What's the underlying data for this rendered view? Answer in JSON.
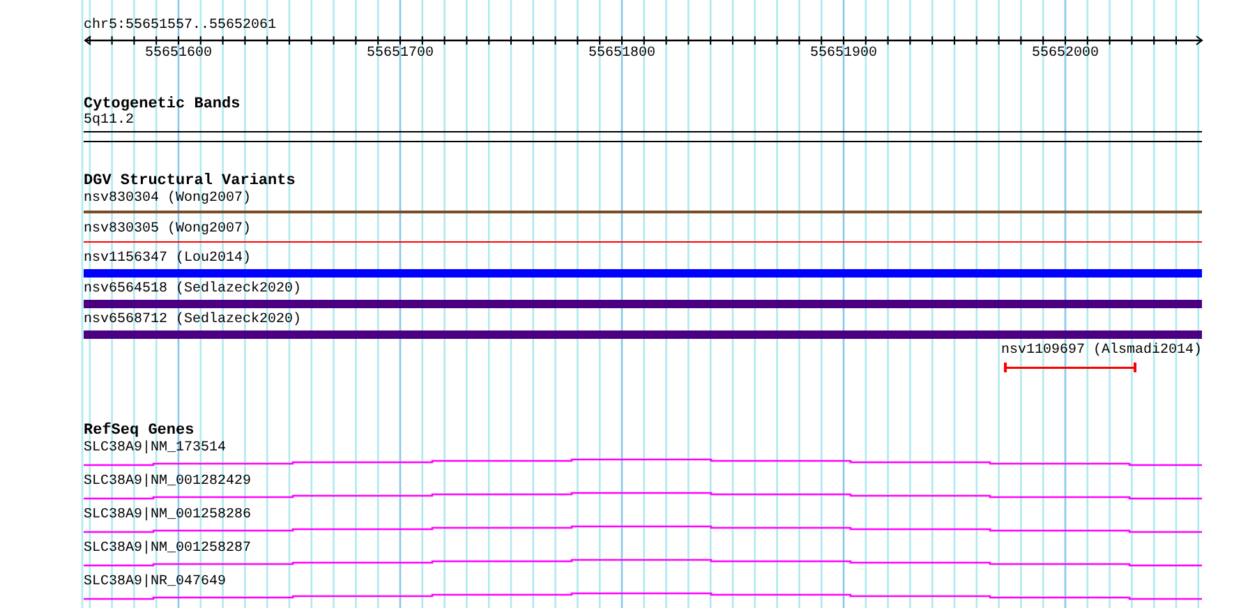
{
  "ruler": {
    "region": "chr5:55651557..55652061",
    "ticks": [
      "55651600",
      "55651700",
      "55651800",
      "55651900",
      "55652000"
    ]
  },
  "tracks": [
    {
      "title": "Cytogenetic Bands",
      "kind": "bands",
      "features": [
        {
          "label": "5q11.2",
          "kind": "band"
        }
      ]
    },
    {
      "title": "DGV Structural Variants",
      "kind": "variants",
      "features": [
        {
          "label": "nsv830304 (Wong2007)",
          "kind": "line",
          "color": "#7b4a26"
        },
        {
          "label": "nsv830305 (Wong2007)",
          "kind": "line",
          "color": "#ff0000"
        },
        {
          "label": "nsv1156347 (Lou2014)",
          "kind": "bar",
          "color": "#0000ff"
        },
        {
          "label": "nsv6564518 (Sedlazeck2020)",
          "kind": "bar",
          "color": "#4b0082"
        },
        {
          "label": "nsv6568712 (Sedlazeck2020)",
          "kind": "bar",
          "color": "#4b0082"
        },
        {
          "label": "nsv1109697 (Alsmadi2014)",
          "kind": "span",
          "color": "#ff0000"
        }
      ]
    },
    {
      "title": "RefSeq Genes",
      "kind": "genes",
      "features": [
        {
          "label": "SLC38A9|NM_173514",
          "kind": "gene"
        },
        {
          "label": "SLC38A9|NM_001282429",
          "kind": "gene"
        },
        {
          "label": "SLC38A9|NM_001258286",
          "kind": "gene"
        },
        {
          "label": "SLC38A9|NM_001258287",
          "kind": "gene"
        },
        {
          "label": "SLC38A9|NR_047649",
          "kind": "gene"
        }
      ]
    }
  ]
}
